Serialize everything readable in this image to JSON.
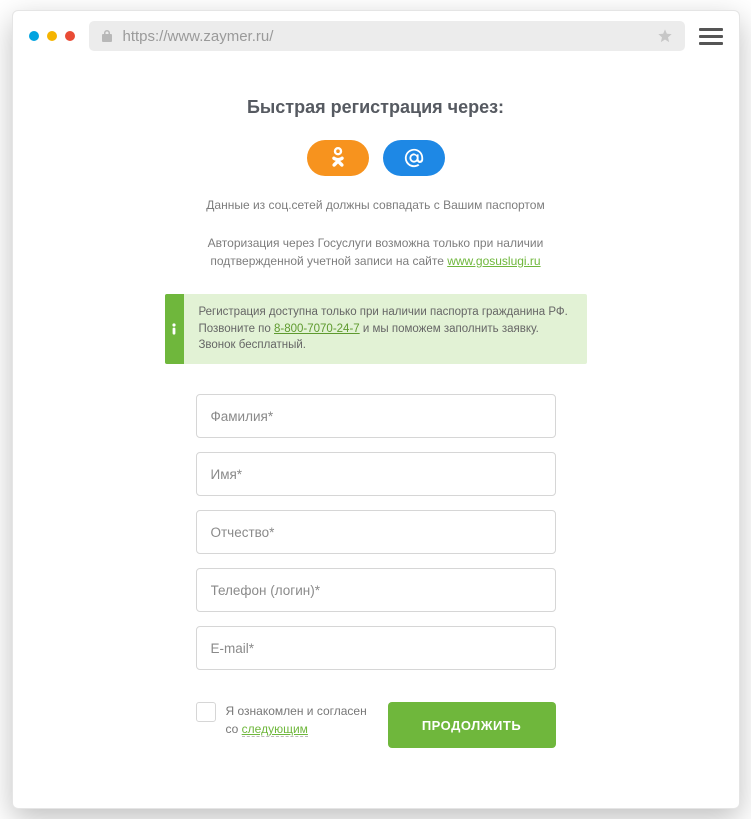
{
  "browser": {
    "url": "https://www.zaymer.ru/"
  },
  "heading": "Быстрая регистрация через:",
  "note_social": "Данные из соц.сетей должны совпадать с Вашим паспортом",
  "note_gosuslugi": {
    "line1": "Авторизация через Госуслуги возможна только при наличии",
    "line2_prefix": "подтвержденной учетной записи на сайте ",
    "link_text": "www.gosuslugi.ru"
  },
  "info": {
    "text_before": "Регистрация доступна только при наличии паспорта гражданина РФ. Позвоните по ",
    "phone": "8-800-7070-24-7",
    "text_after": " и мы поможем заполнить заявку. Звонок бесплатный."
  },
  "form": {
    "lastname": "Фамилия*",
    "firstname": "Имя*",
    "patronymic": "Отчество*",
    "phone": "Телефон (логин)*",
    "email": "E-mail*"
  },
  "consent": {
    "prefix": "Я ознакомлен и согласен",
    "line2_prefix": "со ",
    "link": "следующим"
  },
  "submit": "ПРОДОЛЖИТЬ"
}
